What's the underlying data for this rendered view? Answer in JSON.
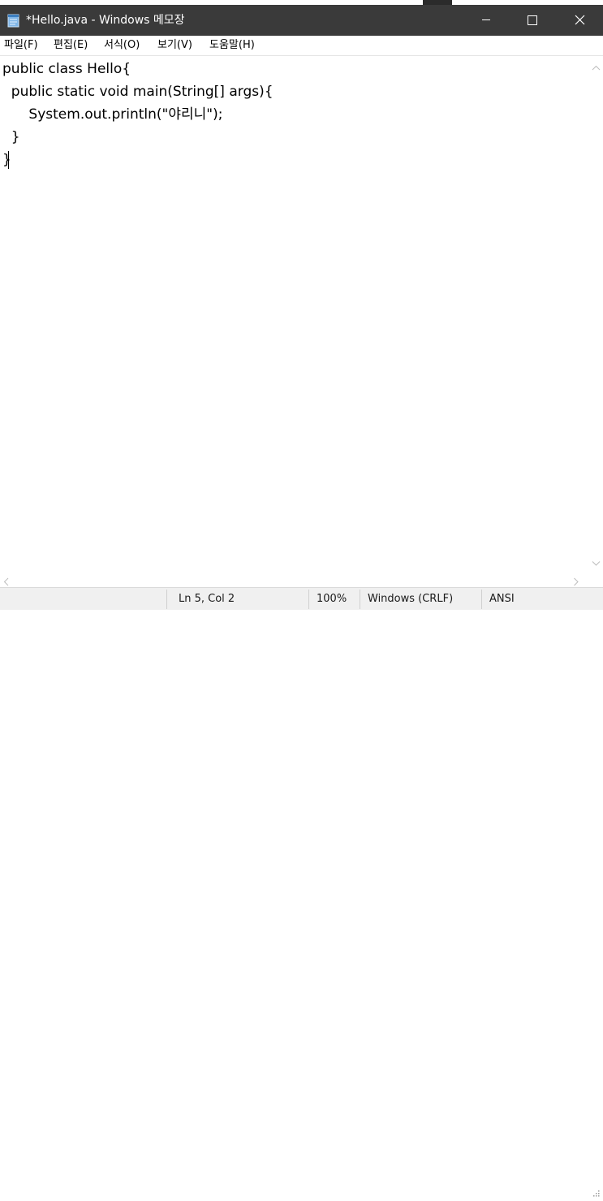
{
  "window": {
    "title": "*Hello.java - Windows 메모장",
    "icon": "notepad-icon",
    "controls": {
      "minimize": "minimize-icon",
      "maximize": "maximize-icon",
      "close": "close-icon"
    }
  },
  "menu": {
    "file": "파일(F)",
    "edit": "편집(E)",
    "format": "서식(O)",
    "view": "보기(V)",
    "help": "도움말(H)"
  },
  "editor": {
    "lines": [
      "public class Hello{",
      "  public static void main(String[] args){",
      "      System.out.println(\"야리니\");",
      "  }",
      "}"
    ]
  },
  "status": {
    "position": "Ln 5, Col 2",
    "zoom": "100%",
    "line_ending": "Windows (CRLF)",
    "encoding": "ANSI"
  },
  "colors": {
    "titlebar": "#3a3a3a",
    "statusbar": "#f0f0f0"
  }
}
